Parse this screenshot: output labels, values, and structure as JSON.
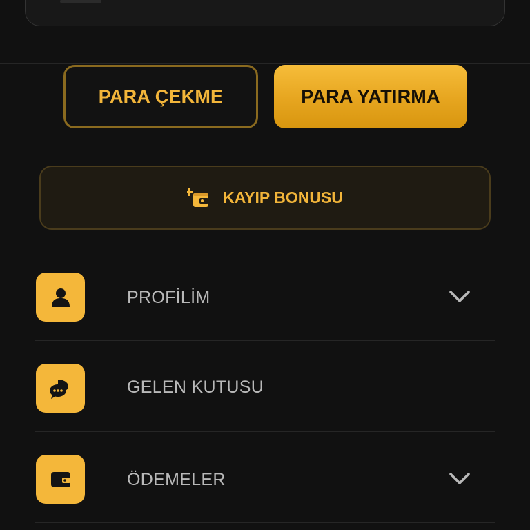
{
  "actions": {
    "withdraw_label": "PARA ÇEKME",
    "deposit_label": "PARA YATIRMA"
  },
  "bonus": {
    "label": "KAYIP BONUSU",
    "icon": "wallet-bonus-icon"
  },
  "menu": {
    "items": [
      {
        "label": "PROFİLİM",
        "icon": "user-icon",
        "has_chevron": true
      },
      {
        "label": "GELEN KUTUSU",
        "icon": "chat-bubbles-icon",
        "has_chevron": false
      },
      {
        "label": "ÖDEMELER",
        "icon": "wallet-icon",
        "has_chevron": true
      }
    ]
  },
  "colors": {
    "background": "#111111",
    "accent": "#f4b73a",
    "accent_dark": "#d8960f",
    "bonus_background": "#1f1b12",
    "muted_text": "#b9b9b9"
  }
}
